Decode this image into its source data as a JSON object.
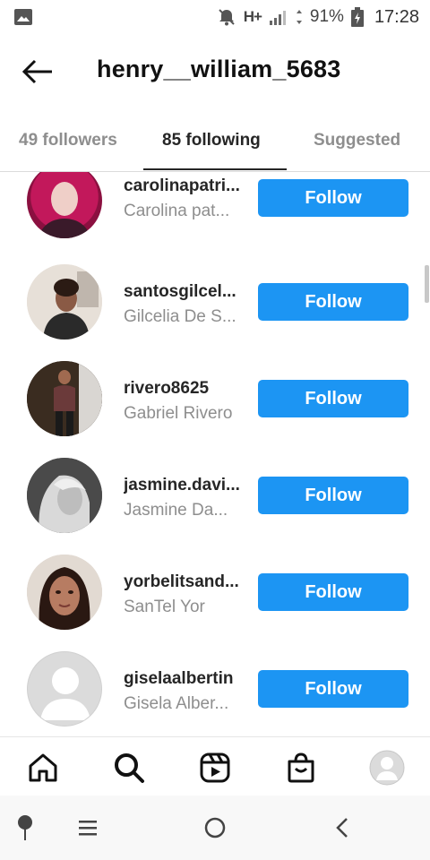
{
  "status_bar": {
    "network": "H+",
    "battery": "91%",
    "time": "17:28"
  },
  "header": {
    "title": "henry__william_5683"
  },
  "tabs": [
    {
      "label": "49 followers"
    },
    {
      "label": "85 following"
    },
    {
      "label": "Suggested"
    }
  ],
  "accounts": [
    {
      "username": "carolinapatri...",
      "full_name": "Carolina pat...",
      "button": "Follow"
    },
    {
      "username": "santosgilcel...",
      "full_name": "Gilcelia De S...",
      "button": "Follow"
    },
    {
      "username": "rivero8625",
      "full_name": "Gabriel Rivero",
      "button": "Follow"
    },
    {
      "username": "jasmine.davi...",
      "full_name": "Jasmine Da...",
      "button": "Follow"
    },
    {
      "username": "yorbelitsand...",
      "full_name": "SanTel Yor",
      "button": "Follow"
    },
    {
      "username": "giselaalbertin",
      "full_name": "Gisela Alber...",
      "button": "Follow"
    }
  ],
  "icons": {
    "status_left": "image-icon",
    "back": "back-arrow-icon",
    "nav": [
      "home-icon",
      "search-icon",
      "reels-icon",
      "shop-icon",
      "profile-avatar"
    ],
    "system": [
      "assistant-icon",
      "recents-icon",
      "home-circle-icon",
      "back-chevron-icon"
    ]
  },
  "colors": {
    "accent": "#1c95f3",
    "text": "#262626",
    "secondary_text": "#8e8e8e"
  }
}
